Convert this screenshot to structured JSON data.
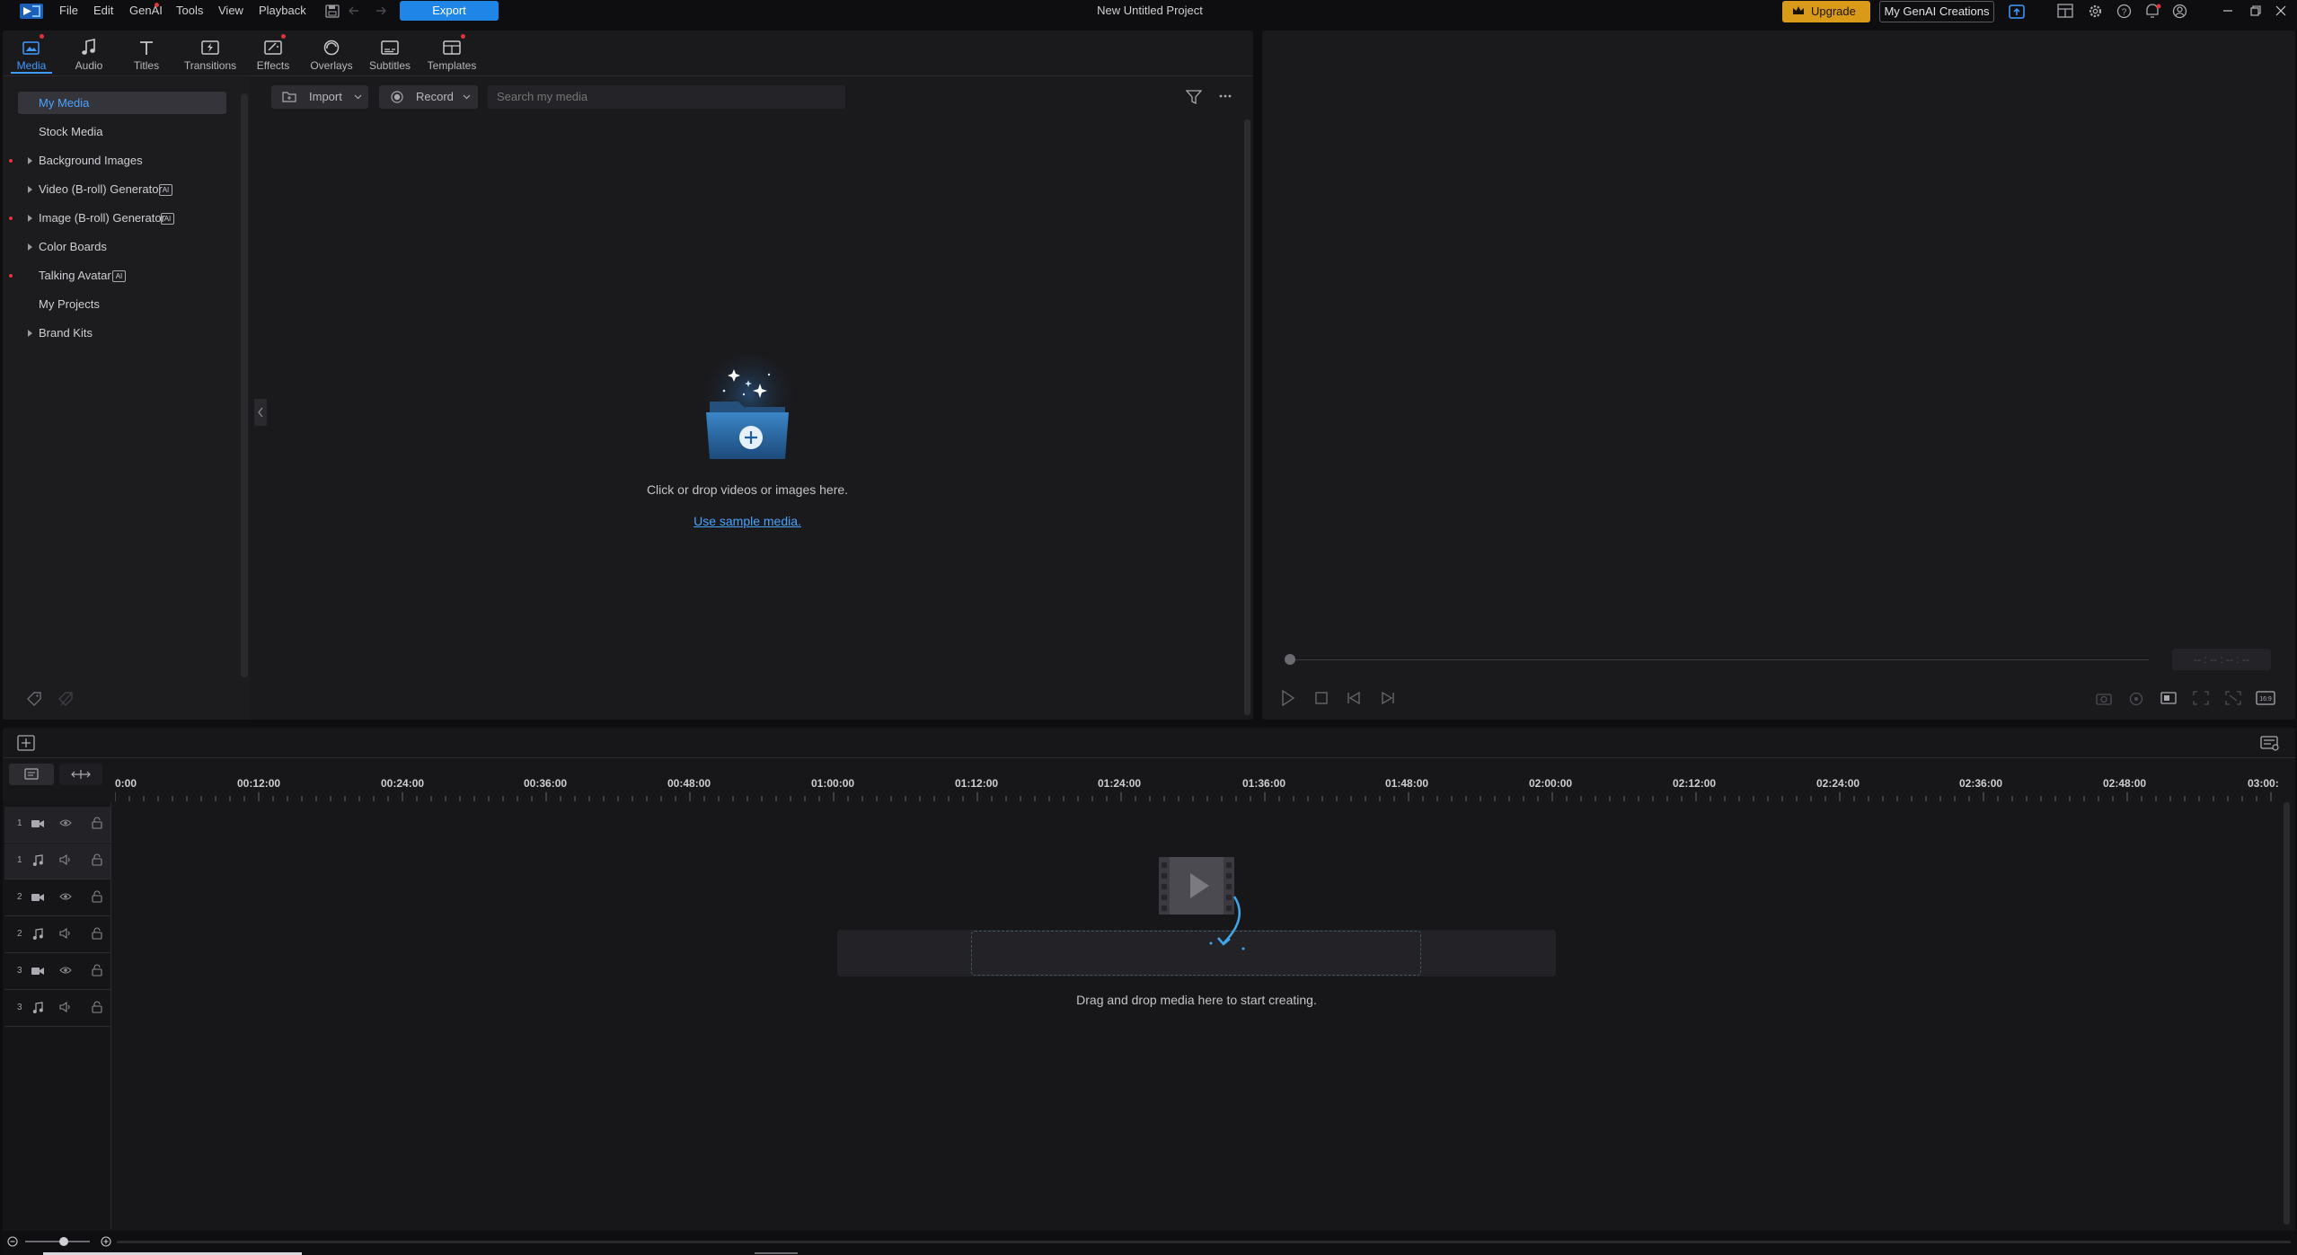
{
  "menubar": {
    "items": [
      "File",
      "Edit",
      "GenAI",
      "Tools",
      "View",
      "Playback"
    ],
    "export_label": "Export",
    "project_title": "New Untitled Project",
    "upgrade_label": "Upgrade",
    "genai_creations_label": "My GenAI Creations"
  },
  "tabs": [
    {
      "label": "Media",
      "icon": "media-icon",
      "active": true
    },
    {
      "label": "Audio",
      "icon": "music-note-icon"
    },
    {
      "label": "Titles",
      "icon": "text-icon"
    },
    {
      "label": "Transitions",
      "icon": "transition-icon"
    },
    {
      "label": "Effects",
      "icon": "effects-icon"
    },
    {
      "label": "Overlays",
      "icon": "overlays-icon"
    },
    {
      "label": "Subtitles",
      "icon": "subtitles-icon"
    },
    {
      "label": "Templates",
      "icon": "templates-icon"
    }
  ],
  "sidebar": {
    "items": [
      {
        "label": "My Media",
        "selected": true
      },
      {
        "label": "Stock Media"
      },
      {
        "label": "Background Images",
        "expandable": true,
        "new_dot": true
      },
      {
        "label": "Video (B-roll) Generator",
        "expandable": true,
        "ai_badge": "AI"
      },
      {
        "label": "Image (B-roll) Generator",
        "expandable": true,
        "ai_badge": "AI",
        "new_dot": true
      },
      {
        "label": "Color Boards",
        "expandable": true
      },
      {
        "label": "Talking Avatar",
        "ai_badge": "AI",
        "new_dot": true
      },
      {
        "label": "My Projects"
      },
      {
        "label": "Brand Kits",
        "expandable": true
      }
    ]
  },
  "media_toolbar": {
    "import_label": "Import",
    "record_label": "Record",
    "search_placeholder": "Search my media"
  },
  "media_empty": {
    "prompt": "Click or drop videos or images here.",
    "sample_link": "Use sample media."
  },
  "player": {
    "timecode": "-- : -- : -- : --"
  },
  "timeline": {
    "ruler_labels": [
      "0:00",
      "00:12:00",
      "00:24:00",
      "00:36:00",
      "00:48:00",
      "01:00:00",
      "01:12:00",
      "01:24:00",
      "01:36:00",
      "01:48:00",
      "02:00:00",
      "02:12:00",
      "02:24:00",
      "02:36:00",
      "02:48:00",
      "03:00:"
    ],
    "tracks": [
      {
        "num": "1",
        "kind": "video"
      },
      {
        "num": "1",
        "kind": "audio"
      },
      {
        "num": "2",
        "kind": "video"
      },
      {
        "num": "2",
        "kind": "audio"
      },
      {
        "num": "3",
        "kind": "video"
      },
      {
        "num": "3",
        "kind": "audio"
      }
    ],
    "drop_prompt": "Drag and drop media here to start creating."
  }
}
